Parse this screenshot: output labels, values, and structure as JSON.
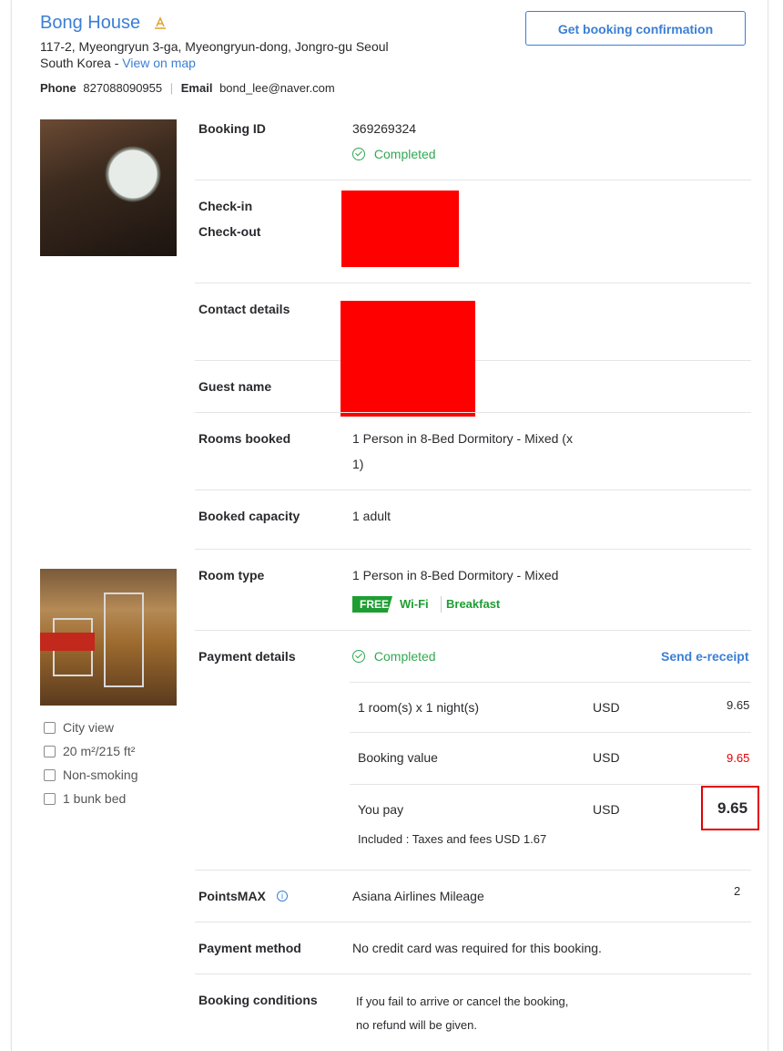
{
  "hotel": {
    "name": "Bong House",
    "address_line1": "117-2, Myeongryun 3-ga, Myeongryun-dong, Jongro-gu Seoul",
    "address_line2": "South Korea - ",
    "view_map": "View on map",
    "phone_label": "Phone",
    "phone": "827088090955",
    "email_label": "Email",
    "email": "bond_lee@naver.com",
    "confirm_button": "Get booking confirmation"
  },
  "booking": {
    "id_label": "Booking ID",
    "id": "369269324",
    "status": "Completed",
    "checkin_label": "Check-in",
    "checkout_label": "Check-out",
    "contact_label": "Contact details",
    "guest_label": "Guest name",
    "rooms_label": "Rooms booked",
    "rooms_line1": "1 Person in 8-Bed Dormitory - Mixed (x",
    "rooms_line2": "1)",
    "capacity_label": "Booked capacity",
    "capacity": "1 adult",
    "room_type_label": "Room type",
    "room_type": "1 Person in 8-Bed Dormitory - Mixed",
    "free_badge": "FREE",
    "wifi": "Wi-Fi",
    "breakfast": "Breakfast"
  },
  "amenities": [
    {
      "icon": "city-view-icon",
      "label": "City view"
    },
    {
      "icon": "room-size-icon",
      "label": "20 m²/215 ft²"
    },
    {
      "icon": "non-smoking-icon",
      "label": "Non-smoking"
    },
    {
      "icon": "bed-icon",
      "label": "1 bunk bed"
    }
  ],
  "payment": {
    "label": "Payment details",
    "status": "Completed",
    "send_receipt": "Send e-receipt",
    "rows": [
      {
        "label": "1 room(s) x 1 night(s)",
        "currency": "USD",
        "amount": "9.65"
      },
      {
        "label": "Booking value",
        "currency": "USD",
        "amount": "9.65"
      },
      {
        "label": "You pay",
        "currency": "USD",
        "amount": "9.65"
      }
    ],
    "included": "Included : Taxes and fees USD 1.67"
  },
  "points": {
    "label": "PointsMAX",
    "program": "Asiana Airlines Mileage",
    "value": "2"
  },
  "method": {
    "label": "Payment method",
    "value": "No credit card was required for this booking."
  },
  "conditions": {
    "label": "Booking conditions",
    "line1": "If you fail to arrive or cancel the booking,",
    "line2": "no refund will be given."
  },
  "colors": {
    "link": "#3a7fd5",
    "success": "#32a852",
    "badge": "#1e9e32",
    "warning_amount": "#e00000"
  }
}
